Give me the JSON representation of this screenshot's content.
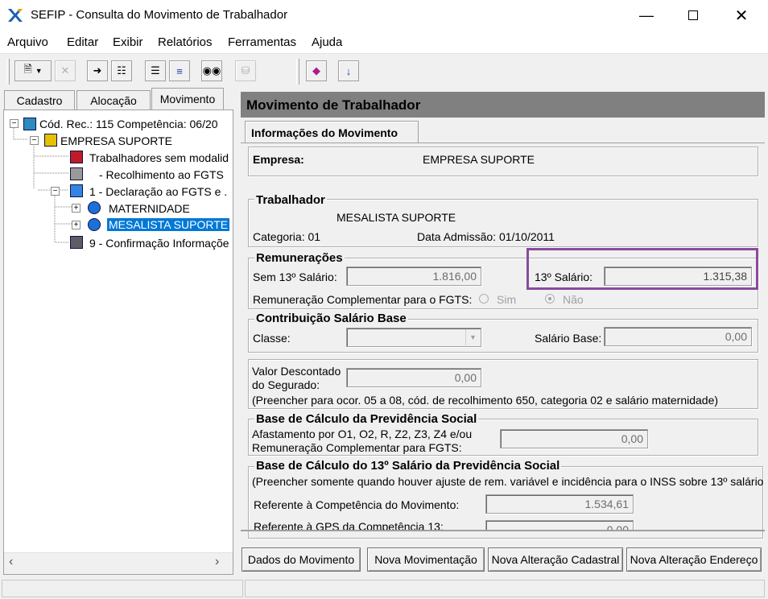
{
  "window": {
    "title": "SEFIP - Consulta do Movimento de Trabalhador"
  },
  "menu": [
    "Arquivo",
    "Editar",
    "Exibir",
    "Relatórios",
    "Ferramentas",
    "Ajuda"
  ],
  "left_tabs": [
    "Cadastro",
    "Alocação",
    "Movimento"
  ],
  "tree": {
    "root": "Cód. Rec.: 115 Competência: 06/20",
    "company": "EMPRESA SUPORTE",
    "items": [
      "Trabalhadores sem modalid",
      "- Recolhimento ao FGTS",
      "1 - Declaração ao FGTS e ."
    ],
    "children": [
      "MATERNIDADE",
      "MESALISTA SUPORTE"
    ],
    "last": "9 - Confirmação Informaçõe"
  },
  "panel": {
    "header": "Movimento de Trabalhador",
    "tab": "Informações do Movimento",
    "empresa_label": "Empresa:",
    "empresa_value": "EMPRESA SUPORTE",
    "trabalhador_title": "Trabalhador",
    "trabalhador_name": "MESALISTA SUPORTE",
    "categoria": "Categoria: 01",
    "admissao": "Data Admissão: 01/10/2011",
    "remun_title": "Remunerações",
    "sem13_label": "Sem 13º Salário:",
    "sem13_value": "1.816,00",
    "sal13_label": "13º Salário:",
    "sal13_value": "1.315,38",
    "remcomp_label": "Remuneração Complementar para o FGTS:",
    "radio_sim": "Sim",
    "radio_nao": "Não",
    "contrib_title": "Contribuição Salário Base",
    "classe_label": "Classe:",
    "classe_value": "",
    "salbase_label": "Salário Base:",
    "salbase_value": "0,00",
    "desc_label1": "Valor Descontado",
    "desc_label2": "do Segurado:",
    "desc_value": "0,00",
    "desc_note": "(Preencher para ocor. 05 a 08, cód. de recolhimento 650, categoria 02 e salário maternidade)",
    "baseprev_title": "Base de Cálculo da Previdência Social",
    "baseprev_label1": "Afastamento por O1, O2, R, Z2, Z3, Z4 e/ou",
    "baseprev_label2": "Remuneração Complementar para FGTS:",
    "baseprev_value": "0,00",
    "base13_title": "Base de Cálculo do 13º Salário da Previdência Social",
    "base13_note": "(Preencher somente quando houver ajuste de rem. variável e incidência para o INSS sobre 13º salário",
    "ref_comp_label": "Referente à Competência do Movimento:",
    "ref_comp_value": "1.534,61",
    "ref_gps_label": "Referente à GPS da Competência 13:",
    "ref_gps_value": "0,00"
  },
  "buttons": {
    "dados": "Dados do Movimento",
    "nova_mov": "Nova Movimentação",
    "nova_alt_cad": "Nova Alteração Cadastral",
    "nova_alt_end": "Nova Alteração Endereço"
  },
  "colors": {
    "highlight": "#8a4a9c",
    "selection": "#0078d7",
    "header": "#808080"
  }
}
